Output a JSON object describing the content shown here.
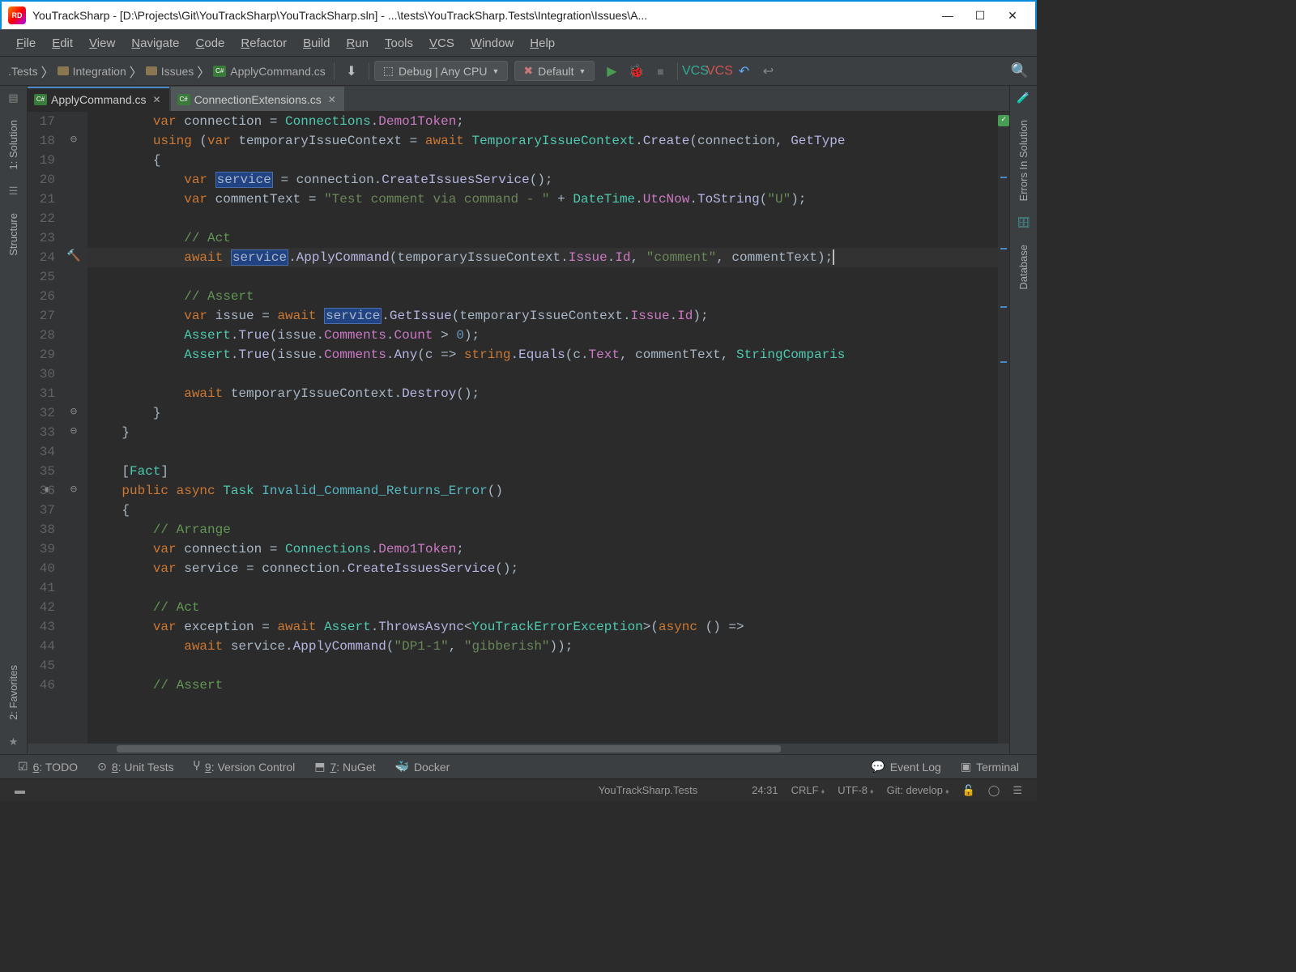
{
  "title": "YouTrackSharp - [D:\\Projects\\Git\\YouTrackSharp\\YouTrackSharp.sln] - ...\\tests\\YouTrackSharp.Tests\\Integration\\Issues\\A...",
  "logo": "RD",
  "menu": [
    "File",
    "Edit",
    "View",
    "Navigate",
    "Code",
    "Refactor",
    "Build",
    "Run",
    "Tools",
    "VCS",
    "Window",
    "Help"
  ],
  "breadcrumbs": [
    {
      "label": ".Tests",
      "icon": "none"
    },
    {
      "label": "Integration",
      "icon": "folder"
    },
    {
      "label": "Issues",
      "icon": "folder"
    },
    {
      "label": "ApplyCommand.cs",
      "icon": "cs"
    }
  ],
  "toolbar": {
    "config1": "Debug | Any CPU",
    "config2": "Default"
  },
  "leftTabs": [
    "1: Solution",
    "Structure",
    "2: Favorites"
  ],
  "rightTabs": [
    "Errors In Solution",
    "Database"
  ],
  "tabs": [
    {
      "label": "ApplyCommand.cs",
      "active": true
    },
    {
      "label": "ConnectionExtensions.cs",
      "active": false
    }
  ],
  "lineStart": 17,
  "lineEnd": 46,
  "currentLine": 24,
  "code": {
    "l17": {
      "indent": "        ",
      "tokens": [
        [
          "kw",
          "var"
        ],
        [
          "ident",
          " connection "
        ],
        [
          "ident",
          "= "
        ],
        [
          "type",
          "Connections"
        ],
        [
          "ident",
          "."
        ],
        [
          "pink",
          "Demo1Token"
        ],
        [
          "ident",
          ";"
        ]
      ]
    },
    "l18": {
      "indent": "        ",
      "tokens": [
        [
          "kw",
          "using"
        ],
        [
          "ident",
          " ("
        ],
        [
          "kw",
          "var"
        ],
        [
          "ident",
          " temporaryIssueContext = "
        ],
        [
          "kw",
          "await"
        ],
        [
          "ident",
          " "
        ],
        [
          "type",
          "TemporaryIssueContext"
        ],
        [
          "ident",
          "."
        ],
        [
          "method",
          "Create"
        ],
        [
          "ident",
          "(connection, "
        ],
        [
          "method",
          "GetType"
        ]
      ]
    },
    "l19": {
      "indent": "        ",
      "tokens": [
        [
          "ident",
          "{"
        ]
      ]
    },
    "l20": {
      "indent": "            ",
      "tokens": [
        [
          "kw",
          "var"
        ],
        [
          "ident",
          " "
        ],
        [
          "srv",
          "service"
        ],
        [
          "ident",
          " = connection."
        ],
        [
          "method",
          "CreateIssuesService"
        ],
        [
          "ident",
          "();"
        ]
      ]
    },
    "l21": {
      "indent": "            ",
      "tokens": [
        [
          "kw",
          "var"
        ],
        [
          "ident",
          " commentText = "
        ],
        [
          "str",
          "\"Test comment via command - \""
        ],
        [
          "ident",
          " + "
        ],
        [
          "type",
          "DateTime"
        ],
        [
          "ident",
          "."
        ],
        [
          "pink",
          "UtcNow"
        ],
        [
          "ident",
          "."
        ],
        [
          "method",
          "ToString"
        ],
        [
          "ident",
          "("
        ],
        [
          "str",
          "\"U\""
        ],
        [
          "ident",
          ");"
        ]
      ]
    },
    "l22": {
      "indent": "",
      "tokens": []
    },
    "l23": {
      "indent": "            ",
      "tokens": [
        [
          "comment green",
          "// Act"
        ]
      ]
    },
    "l24": {
      "indent": "            ",
      "tokens": [
        [
          "kw",
          "await"
        ],
        [
          "ident",
          " "
        ],
        [
          "srv",
          "service"
        ],
        [
          "ident",
          "."
        ],
        [
          "method",
          "ApplyCommand"
        ],
        [
          "ident",
          "(temporaryIssueContext."
        ],
        [
          "pink",
          "Issue"
        ],
        [
          "ident",
          "."
        ],
        [
          "pink",
          "Id"
        ],
        [
          "ident",
          ", "
        ],
        [
          "str",
          "\"comment\""
        ],
        [
          "ident",
          ", commentText);"
        ]
      ]
    },
    "l25": {
      "indent": "",
      "tokens": []
    },
    "l26": {
      "indent": "            ",
      "tokens": [
        [
          "comment green",
          "// Assert"
        ]
      ]
    },
    "l27": {
      "indent": "            ",
      "tokens": [
        [
          "kw",
          "var"
        ],
        [
          "ident",
          " issue = "
        ],
        [
          "kw",
          "await"
        ],
        [
          "ident",
          " "
        ],
        [
          "srv",
          "service"
        ],
        [
          "ident",
          "."
        ],
        [
          "method",
          "GetIssue"
        ],
        [
          "ident",
          "(temporaryIssueContext."
        ],
        [
          "pink",
          "Issue"
        ],
        [
          "ident",
          "."
        ],
        [
          "pink",
          "Id"
        ],
        [
          "ident",
          ");"
        ]
      ]
    },
    "l28": {
      "indent": "            ",
      "tokens": [
        [
          "type",
          "Assert"
        ],
        [
          "ident",
          "."
        ],
        [
          "method",
          "True"
        ],
        [
          "ident",
          "(issue."
        ],
        [
          "pink",
          "Comments"
        ],
        [
          "ident",
          "."
        ],
        [
          "pink",
          "Count"
        ],
        [
          "ident",
          " > "
        ],
        [
          "num",
          "0"
        ],
        [
          "ident",
          ");"
        ]
      ]
    },
    "l29": {
      "indent": "            ",
      "tokens": [
        [
          "type",
          "Assert"
        ],
        [
          "ident",
          "."
        ],
        [
          "method",
          "True"
        ],
        [
          "ident",
          "(issue."
        ],
        [
          "pink",
          "Comments"
        ],
        [
          "ident",
          "."
        ],
        [
          "method",
          "Any"
        ],
        [
          "ident",
          "(c => "
        ],
        [
          "kw",
          "string"
        ],
        [
          "ident",
          "."
        ],
        [
          "method",
          "Equals"
        ],
        [
          "ident",
          "(c."
        ],
        [
          "pink",
          "Text"
        ],
        [
          "ident",
          ", commentText, "
        ],
        [
          "type",
          "StringComparis"
        ]
      ]
    },
    "l30": {
      "indent": "",
      "tokens": []
    },
    "l31": {
      "indent": "            ",
      "tokens": [
        [
          "kw",
          "await"
        ],
        [
          "ident",
          " temporaryIssueContext."
        ],
        [
          "method",
          "Destroy"
        ],
        [
          "ident",
          "();"
        ]
      ]
    },
    "l32": {
      "indent": "        ",
      "tokens": [
        [
          "ident",
          "}"
        ]
      ]
    },
    "l33": {
      "indent": "    ",
      "tokens": [
        [
          "ident",
          "}"
        ]
      ]
    },
    "l34": {
      "indent": "",
      "tokens": []
    },
    "l35": {
      "indent": "    ",
      "tokens": [
        [
          "ident",
          "["
        ],
        [
          "type",
          "Fact"
        ],
        [
          "ident",
          "]"
        ]
      ]
    },
    "l36": {
      "indent": "    ",
      "tokens": [
        [
          "kw",
          "public"
        ],
        [
          "ident",
          " "
        ],
        [
          "kw",
          "async"
        ],
        [
          "ident",
          " "
        ],
        [
          "type",
          "Task"
        ],
        [
          "ident",
          " "
        ],
        [
          "methdef",
          "Invalid_Command_Returns_Error"
        ],
        [
          "ident",
          "()"
        ]
      ]
    },
    "l37": {
      "indent": "    ",
      "tokens": [
        [
          "ident",
          "{"
        ]
      ]
    },
    "l38": {
      "indent": "        ",
      "tokens": [
        [
          "comment green",
          "// Arrange"
        ]
      ]
    },
    "l39": {
      "indent": "        ",
      "tokens": [
        [
          "kw",
          "var"
        ],
        [
          "ident",
          " connection = "
        ],
        [
          "type",
          "Connections"
        ],
        [
          "ident",
          "."
        ],
        [
          "pink",
          "Demo1Token"
        ],
        [
          "ident",
          ";"
        ]
      ]
    },
    "l40": {
      "indent": "        ",
      "tokens": [
        [
          "kw",
          "var"
        ],
        [
          "ident",
          " service = connection."
        ],
        [
          "method",
          "CreateIssuesService"
        ],
        [
          "ident",
          "();"
        ]
      ]
    },
    "l41": {
      "indent": "",
      "tokens": []
    },
    "l42": {
      "indent": "        ",
      "tokens": [
        [
          "comment green",
          "// Act"
        ]
      ]
    },
    "l43": {
      "indent": "        ",
      "tokens": [
        [
          "kw",
          "var"
        ],
        [
          "ident",
          " exception = "
        ],
        [
          "kw",
          "await"
        ],
        [
          "ident",
          " "
        ],
        [
          "type",
          "Assert"
        ],
        [
          "ident",
          "."
        ],
        [
          "method",
          "ThrowsAsync"
        ],
        [
          "ident",
          "<"
        ],
        [
          "type",
          "YouTrackErrorException"
        ],
        [
          "ident",
          ">("
        ],
        [
          "kw",
          "async"
        ],
        [
          "ident",
          " () =>"
        ]
      ]
    },
    "l44": {
      "indent": "            ",
      "tokens": [
        [
          "kw",
          "await"
        ],
        [
          "ident",
          " service."
        ],
        [
          "method",
          "ApplyCommand"
        ],
        [
          "ident",
          "("
        ],
        [
          "str",
          "\"DP1-1\""
        ],
        [
          "ident",
          ", "
        ],
        [
          "str",
          "\"gibberish\""
        ],
        [
          "ident",
          "));"
        ]
      ]
    },
    "l45": {
      "indent": "",
      "tokens": []
    },
    "l46": {
      "indent": "        ",
      "tokens": [
        [
          "comment green",
          "// Assert"
        ]
      ]
    }
  },
  "bottomTabs": [
    {
      "icon": "☑",
      "label": "6: TODO",
      "u": "6"
    },
    {
      "icon": "⊙",
      "label": "8: Unit Tests",
      "u": "8"
    },
    {
      "icon": "Ⴤ",
      "label": "9: Version Control",
      "u": "9"
    },
    {
      "icon": "⬒",
      "label": "7: NuGet",
      "u": "7"
    },
    {
      "icon": "🐳",
      "label": "Docker",
      "u": ""
    }
  ],
  "bottomRight": [
    {
      "icon": "💬",
      "label": "Event Log"
    },
    {
      "icon": "▣",
      "label": "Terminal"
    }
  ],
  "status": {
    "project": "YouTrackSharp.Tests",
    "pos": "24:31",
    "eol": "CRLF",
    "enc": "UTF-8",
    "git": "Git: develop"
  }
}
